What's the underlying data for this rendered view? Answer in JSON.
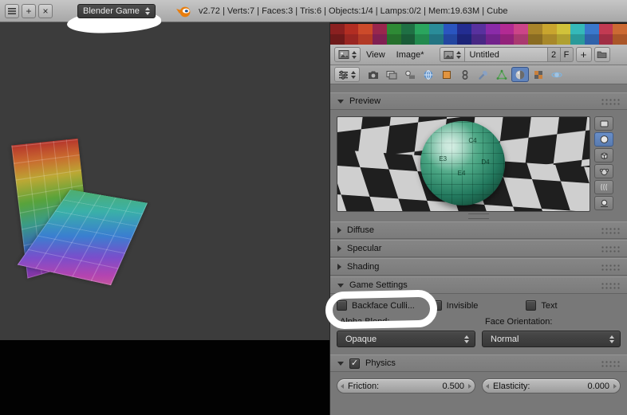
{
  "topbar": {
    "add_button": "+",
    "close_button": "×",
    "engine_dropdown": {
      "value": "Blender Game"
    },
    "stats": "v2.72 | Verts:7 | Faces:3 | Tris:6 | Objects:1/4 | Lamps:0/2 | Mem:19.63M | Cube"
  },
  "image_editor": {
    "menus": {
      "view": "View",
      "image": "Image*"
    },
    "datablock": {
      "name": "Untitled",
      "users": "2",
      "fake_user": "F",
      "new_label": "+"
    },
    "palette_rows": [
      [
        "#8a2020",
        "#b22d22",
        "#cc4a2a",
        "#99264d",
        "#2e8a35",
        "#1f7044",
        "#2aa55e",
        "#2a8c99",
        "#2a55c0",
        "#232d91",
        "#58319e",
        "#8a2ba8",
        "#b22a93",
        "#cc4488",
        "#a8842a",
        "#c9a52e",
        "#d1c23a",
        "#35b9b9",
        "#3a78cc",
        "#c23a52",
        "#cc6a33"
      ],
      [
        "#6e1a1a",
        "#992622",
        "#b23a26",
        "#802052",
        "#26702c",
        "#1a5c38",
        "#228a4e",
        "#227482",
        "#2346a0",
        "#1c2478",
        "#482884",
        "#72238c",
        "#93227a",
        "#aa3a70",
        "#8a6c22",
        "#a8882a",
        "#b0a030",
        "#2a9a9a",
        "#2f62aa",
        "#a02e44",
        "#aa5628"
      ]
    ]
  },
  "properties_tabs": {
    "active": "material",
    "names": [
      "render",
      "render-layers",
      "scene",
      "world",
      "object",
      "constraints",
      "modifiers",
      "object-data",
      "material",
      "texture",
      "physics"
    ]
  },
  "panels": {
    "preview": {
      "title": "Preview",
      "sphere_labels": [
        "C4",
        "D4",
        "E4",
        "E3"
      ]
    },
    "diffuse": {
      "title": "Diffuse"
    },
    "specular": {
      "title": "Specular"
    },
    "shading": {
      "title": "Shading"
    },
    "game_settings": {
      "title": "Game Settings",
      "backface_label": "Backface Culli...",
      "invisible_label": "Invisible",
      "text_label": "Text",
      "alpha_blend_label": "Alpha Blend:",
      "alpha_blend_value": "Opaque",
      "face_orientation_label": "Face Orientation:",
      "face_orientation_value": "Normal"
    },
    "physics": {
      "title": "Physics",
      "checked_glyph": "✓",
      "friction_label": "Friction:",
      "friction_value": "0.500",
      "elasticity_label": "Elasticity:",
      "elasticity_value": "0.000"
    }
  },
  "colors": {
    "tab_active": "#6084bd",
    "annotation_highlight": "#ffffff",
    "viewport_bg": "#3c3c3c"
  }
}
